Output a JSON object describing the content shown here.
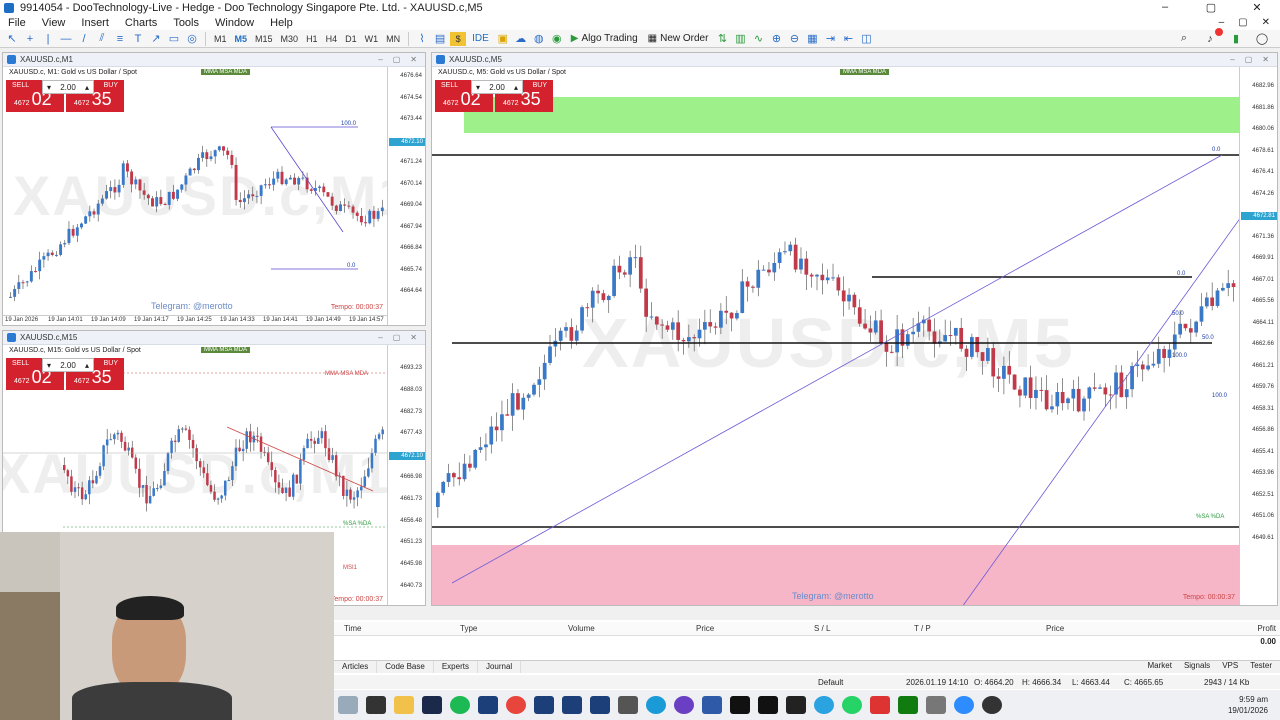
{
  "window": {
    "title": "9914054 - DooTechnology-Live - Hedge - Doo Technology Singapore Pte. Ltd. - XAUUSD.c,M5",
    "controls": [
      "–",
      "▢",
      "✕"
    ]
  },
  "menu": [
    "File",
    "View",
    "Insert",
    "Charts",
    "Tools",
    "Window",
    "Help"
  ],
  "toolbar": {
    "timeframes": [
      "M1",
      "M5",
      "M15",
      "M30",
      "H1",
      "H4",
      "D1",
      "W1",
      "MN"
    ],
    "active_tf": "M5",
    "ide_label": "IDE",
    "algo_label": "Algo Trading",
    "neworder_label": "New Order"
  },
  "trade_panel": {
    "sell_label": "SELL",
    "buy_label": "BUY",
    "lot": "2.00",
    "sell_big": "4672",
    "sell_small": "02",
    "buy_big": "4672",
    "buy_small": "35"
  },
  "charts": {
    "m1": {
      "win_title": "XAUUSD.c,M1",
      "symbol": "XAUUSD.c, M1:  Gold vs US Dollar / Spot",
      "watermark": "XAUUSD.c,M1",
      "telegram": "Telegram: @merotto",
      "tempo": "Tempo: 00:00:37",
      "current_price": "4672.10",
      "prices": [
        "4676.64",
        "4674.54",
        "4673.44",
        "4672.10",
        "4671.24",
        "4670.14",
        "4669.04",
        "4667.94",
        "4666.84",
        "4665.74",
        "4664.64"
      ],
      "times": [
        "19 Jan 2026",
        "19 Jan 14:01",
        "19 Jan 14:09",
        "19 Jan 14:17",
        "19 Jan 14:25",
        "19 Jan 14:33",
        "19 Jan 14:41",
        "19 Jan 14:49",
        "19 Jan 14:57"
      ],
      "fib_top": "100.0",
      "fib_bottom": "0.0"
    },
    "m15": {
      "win_title": "XAUUSD.c,M15",
      "symbol": "XAUUSD.c, M15:  Gold vs US Dollar / Spot",
      "watermark": "XAUUSD.c,M15",
      "tempo": "Tempo: 00:00:37",
      "current_price": "4672.10",
      "prices": [
        "4693.23",
        "4688.03",
        "4682.73",
        "4677.43",
        "4672.10",
        "4666.98",
        "4661.73",
        "4656.48",
        "4651.23",
        "4645.98",
        "4640.73"
      ],
      "mma_label": "MMA  MSA  MDA",
      "sa_label": "%SA  %DA",
      "msi_label": "MSI1"
    },
    "m5": {
      "win_title": "XAUUSD.c,M5",
      "symbol": "XAUUSD.c, M5:  Gold vs US Dollar / Spot",
      "watermark": "XAUUSD.c,M5",
      "telegram": "Telegram: @merotto",
      "tempo": "Tempo: 00:00:37",
      "current_price": "4672.10",
      "prices": [
        "4682.96",
        "4681.86",
        "4680.06",
        "4678.61",
        "4676.41",
        "4674.26",
        "4672.81",
        "4671.36",
        "4669.91",
        "4667.01",
        "4665.56",
        "4664.11",
        "4662.66",
        "4661.21",
        "4659.76",
        "4658.31",
        "4656.86",
        "4655.41",
        "4653.96",
        "4652.51",
        "4651.06",
        "4649.61"
      ],
      "fib_labels": [
        "0.0",
        "50.0",
        "100.0",
        "0.0",
        "50.0",
        "100.0"
      ],
      "sa_label": "%SA  %DA"
    }
  },
  "trade_table": {
    "columns": [
      "Time",
      "Type",
      "Volume",
      "Price",
      "S / L",
      "T / P",
      "Price",
      "Profit"
    ],
    "profit_total": "0.00"
  },
  "tabs": [
    "Articles",
    "Code Base",
    "Experts",
    "Journal"
  ],
  "tabs_right": [
    "Market",
    "Signals",
    "VPS",
    "Tester"
  ],
  "status": {
    "profile": "Default",
    "datetime": "2026.01.19 14:10",
    "open": "O: 4664.20",
    "high": "H: 4666.34",
    "low": "L: 4663.44",
    "close": "C: 4665.65",
    "traffic": "2943 / 14 Kb"
  },
  "clock": {
    "time": "9:59 am",
    "date": "19/01/2026"
  },
  "colors": {
    "bull": "#3a78c8",
    "bear": "#c03a4a",
    "zone_green": "#9ef08a",
    "zone_pink": "#f7b6c8",
    "sell_red": "#d3222d"
  }
}
